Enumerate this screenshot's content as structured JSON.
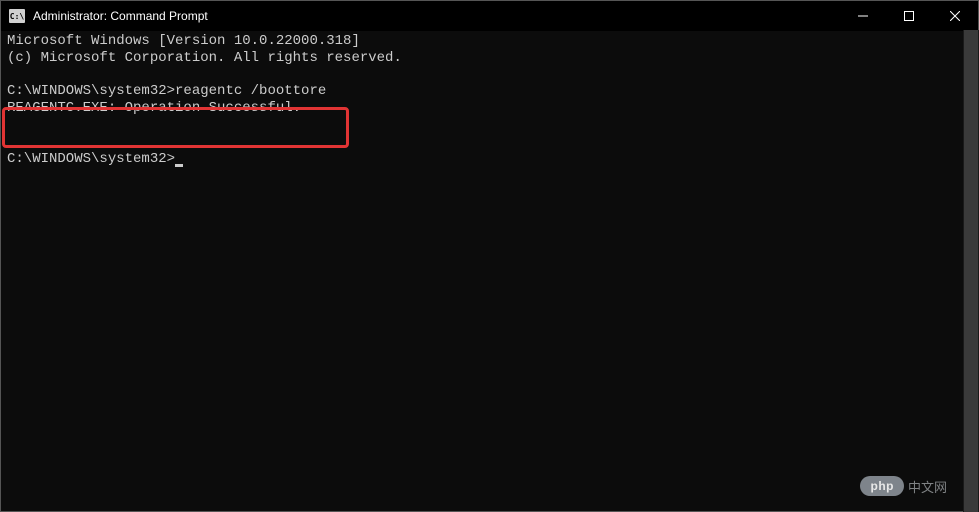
{
  "titlebar": {
    "title": "Administrator: Command Prompt"
  },
  "terminal": {
    "header_line1": "Microsoft Windows [Version 10.0.22000.318]",
    "header_line2": "(c) Microsoft Corporation. All rights reserved.",
    "prompt1": "C:\\WINDOWS\\system32>",
    "command1": "reagentc /boottore",
    "output1": "REAGENTC.EXE: Operation Successful.",
    "prompt2": "C:\\WINDOWS\\system32>"
  },
  "watermark": {
    "badge": "php",
    "text": "中文网"
  }
}
